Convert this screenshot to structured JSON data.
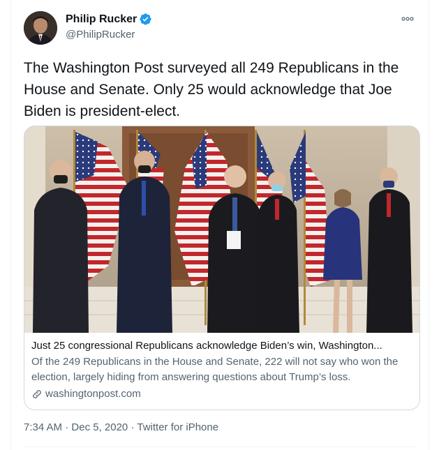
{
  "tweet": {
    "author_name": "Philip Rucker",
    "author_handle": "@PhilipRucker",
    "verified_icon": "verified-badge-icon",
    "more_icon": "more-options-icon",
    "text": "The Washington Post surveyed all 249 Republicans in the House and Senate. Only 25 would acknowledge that Joe Biden is president-elect.",
    "time": "7:34 AM",
    "separator": "·",
    "date": "Dec 5, 2020",
    "source": "Twitter for iPhone"
  },
  "card": {
    "title": "Just 25 congressional Republicans acknowledge Biden’s win, Washington...",
    "description": "Of the 249 Republicans in the House and Senate, 222 will not say who won the election, largely hiding from answering questions about Trump’s loss.",
    "link_icon": "link-icon",
    "domain": "washingtonpost.com"
  },
  "colors": {
    "verified_blue": "#1d9bf0",
    "secondary_text": "#536471",
    "border": "#cfd9de"
  }
}
